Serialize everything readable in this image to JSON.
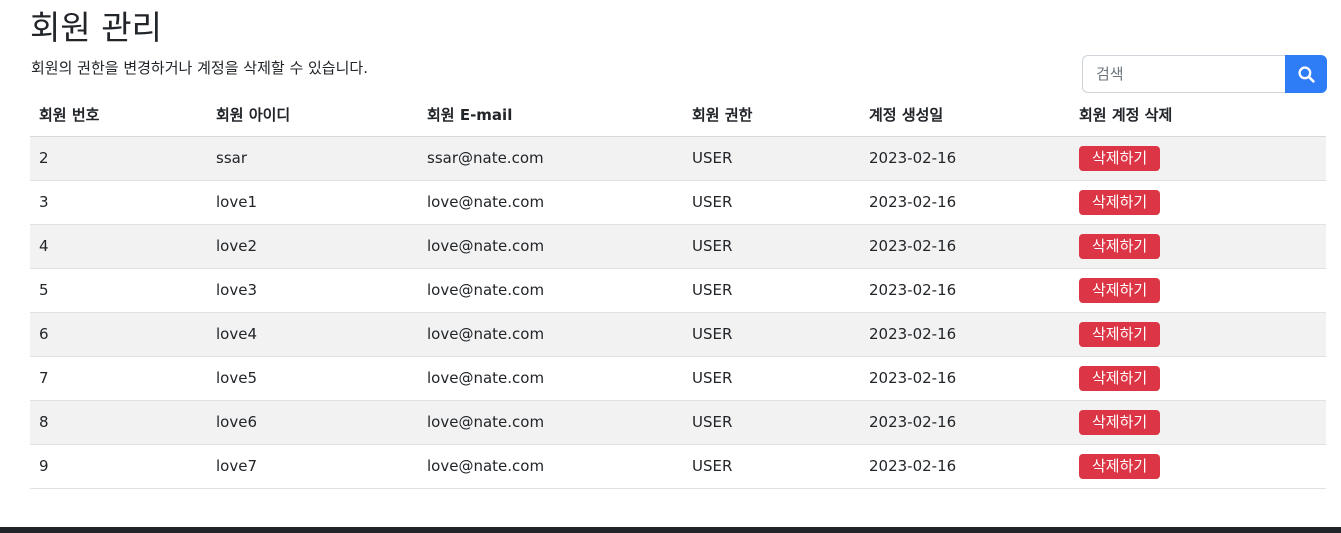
{
  "page": {
    "title": "회원 관리",
    "subtitle": "회원의 권한을 변경하거나 계정을 삭제할 수 있습니다."
  },
  "search": {
    "placeholder": "검색",
    "button_icon": "search-icon",
    "button_color": "#2f7df6"
  },
  "table": {
    "headers": [
      "회원 번호",
      "회원 아이디",
      "회원 E-mail",
      "회원 권한",
      "계정 생성일",
      "회원 계정 삭제"
    ],
    "delete_label": "삭제하기",
    "delete_color": "#dc3545",
    "rows": [
      {
        "id": "2",
        "username": "ssar",
        "email": "ssar@nate.com",
        "role": "USER",
        "created": "2023-02-16",
        "action": "삭제하기"
      },
      {
        "id": "3",
        "username": "love1",
        "email": "love@nate.com",
        "role": "USER",
        "created": "2023-02-16",
        "action": "삭제하기"
      },
      {
        "id": "4",
        "username": "love2",
        "email": "love@nate.com",
        "role": "USER",
        "created": "2023-02-16",
        "action": "삭제하기"
      },
      {
        "id": "5",
        "username": "love3",
        "email": "love@nate.com",
        "role": "USER",
        "created": "2023-02-16",
        "action": "삭제하기"
      },
      {
        "id": "6",
        "username": "love4",
        "email": "love@nate.com",
        "role": "USER",
        "created": "2023-02-16",
        "action": "삭제하기"
      },
      {
        "id": "7",
        "username": "love5",
        "email": "love@nate.com",
        "role": "USER",
        "created": "2023-02-16",
        "action": "삭제하기"
      },
      {
        "id": "8",
        "username": "love6",
        "email": "love@nate.com",
        "role": "USER",
        "created": "2023-02-16",
        "action": "삭제하기"
      },
      {
        "id": "9",
        "username": "love7",
        "email": "love@nate.com",
        "role": "USER",
        "created": "2023-02-16",
        "action": "삭제하기"
      }
    ]
  }
}
